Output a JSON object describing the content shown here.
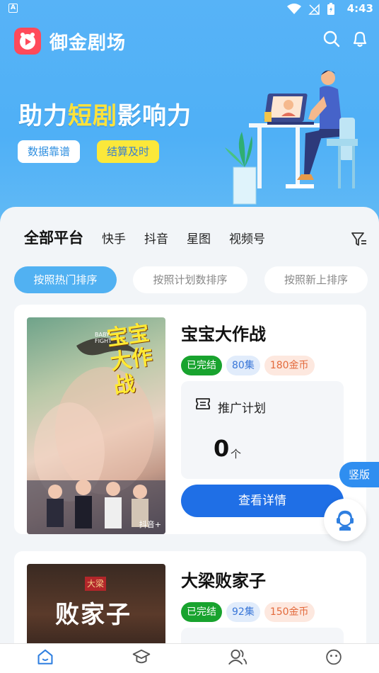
{
  "status_bar": {
    "time": "4:43",
    "left_badge": "A"
  },
  "app": {
    "title": "御金剧场"
  },
  "banner": {
    "slogan_part1": "助力",
    "slogan_highlight": "短剧",
    "slogan_part2": "影响力",
    "tags": [
      "数据靠谱",
      "结算及时"
    ]
  },
  "platform_filters": [
    "全部平台",
    "快手",
    "抖音",
    "星图",
    "视频号"
  ],
  "sort_options": [
    "按照热门排序",
    "按照计划数排序",
    "按照新上排序"
  ],
  "dramas": [
    {
      "title": "宝宝大作战",
      "status": "已完结",
      "episodes": "80集",
      "price": "180金币",
      "plan_label": "推广计划",
      "plan_count": "0",
      "plan_unit": "个",
      "detail_button": "查看详情",
      "poster_title": "宝宝大作战",
      "poster_sub": "BABY FIGHT",
      "poster_source": "抖音+"
    },
    {
      "title": "大梁败家子",
      "status": "已完结",
      "episodes": "92集",
      "price": "150金币",
      "poster_title": "败家子",
      "poster_top": "大梁"
    }
  ],
  "side_tab": "竖版",
  "colors": {
    "primary": "#1f6fe6",
    "hero": "#57b3f7",
    "done_green": "#18a32e"
  },
  "bottom_nav": [
    {
      "icon": "home-icon",
      "label": ""
    },
    {
      "icon": "graduation-cap-icon",
      "label": ""
    },
    {
      "icon": "users-icon",
      "label": ""
    },
    {
      "icon": "smile-icon",
      "label": ""
    }
  ]
}
